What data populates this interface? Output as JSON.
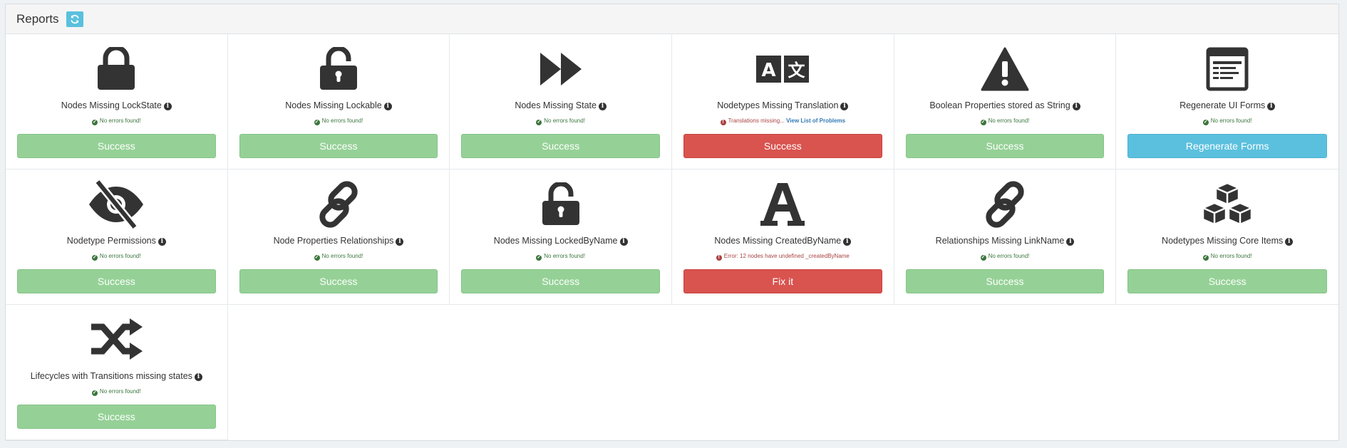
{
  "header": {
    "title": "Reports"
  },
  "reports": [
    {
      "title": "Nodes Missing LockState",
      "status": "No errors found!",
      "status_type": "ok",
      "button": "Success",
      "button_style": "success",
      "icon": "lock-icon"
    },
    {
      "title": "Nodes Missing Lockable",
      "status": "No errors found!",
      "status_type": "ok",
      "button": "Success",
      "button_style": "success",
      "icon": "unlock-icon"
    },
    {
      "title": "Nodes Missing State",
      "status": "No errors found!",
      "status_type": "ok",
      "button": "Success",
      "button_style": "success",
      "icon": "fast-forward-icon"
    },
    {
      "title": "Nodetypes Missing Translation",
      "status": "Translations missing...",
      "status_link": "View List of Problems",
      "status_type": "error",
      "button": "Success",
      "button_style": "danger",
      "icon": "translate-icon"
    },
    {
      "title": "Boolean Properties stored as String",
      "status": "No errors found!",
      "status_type": "ok",
      "button": "Success",
      "button_style": "success",
      "icon": "warning-icon"
    },
    {
      "title": "Regenerate UI Forms",
      "status": "No errors found!",
      "status_type": "ok",
      "button": "Regenerate Forms",
      "button_style": "info",
      "icon": "form-icon"
    },
    {
      "title": "Nodetype Permissions",
      "status": "No errors found!",
      "status_type": "ok",
      "button": "Success",
      "button_style": "success",
      "icon": "eye-slash-icon"
    },
    {
      "title": "Node Properties Relationships",
      "status": "No errors found!",
      "status_type": "ok",
      "button": "Success",
      "button_style": "success",
      "icon": "link-icon"
    },
    {
      "title": "Nodes Missing LockedByName",
      "status": "No errors found!",
      "status_type": "ok",
      "button": "Success",
      "button_style": "success",
      "icon": "unlock-icon"
    },
    {
      "title": "Nodes Missing CreatedByName",
      "status": "Error: 12 nodes have undefined _createdByName",
      "status_type": "error",
      "button": "Fix it",
      "button_style": "danger",
      "icon": "font-icon"
    },
    {
      "title": "Relationships Missing LinkName",
      "status": "No errors found!",
      "status_type": "ok",
      "button": "Success",
      "button_style": "success",
      "icon": "link-icon"
    },
    {
      "title": "Nodetypes Missing Core Items",
      "status": "No errors found!",
      "status_type": "ok",
      "button": "Success",
      "button_style": "success",
      "icon": "cubes-icon"
    },
    {
      "title": "Lifecycles with Transitions missing states",
      "status": "No errors found!",
      "status_type": "ok",
      "button": "Success",
      "button_style": "success",
      "icon": "random-icon"
    }
  ],
  "colors": {
    "success": "#95d196",
    "danger": "#d9534f",
    "info": "#5bc0de",
    "icon": "#333333"
  }
}
